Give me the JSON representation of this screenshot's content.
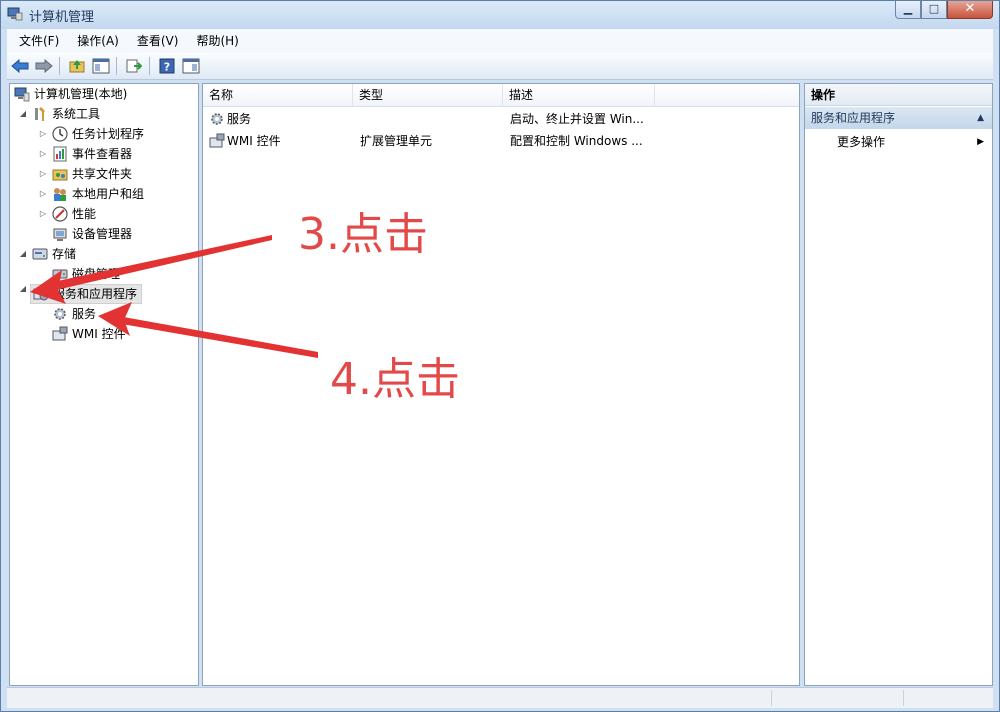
{
  "window": {
    "title": "计算机管理",
    "controls": {
      "minimize": "▁",
      "maximize": "□",
      "close": "✕"
    }
  },
  "menu": [
    "文件(F)",
    "操作(A)",
    "查看(V)",
    "帮助(H)"
  ],
  "toolbar": {
    "buttons": [
      "back-arrow-icon",
      "forward-arrow-icon",
      "up-folder-icon",
      "show-hide-tree-icon",
      "export-list-icon",
      "help-icon",
      "show-hide-action-pane-icon"
    ]
  },
  "tree": {
    "root": "计算机管理(本地)",
    "system_tools": "系统工具",
    "task_scheduler": "任务计划程序",
    "event_viewer": "事件查看器",
    "shared_folders": "共享文件夹",
    "local_users": "本地用户和组",
    "performance": "性能",
    "device_manager": "设备管理器",
    "storage": "存储",
    "disk_management": "磁盘管理",
    "services_apps": "服务和应用程序",
    "services": "服务",
    "wmi": "WMI 控件"
  },
  "list": {
    "columns": [
      "名称",
      "类型",
      "描述"
    ],
    "rows": [
      {
        "name": "服务",
        "type": "",
        "desc": "启动、终止并设置 Win..."
      },
      {
        "name": "WMI 控件",
        "type": "扩展管理单元",
        "desc": "配置和控制 Windows ..."
      }
    ]
  },
  "actions": {
    "header": "操作",
    "section": "服务和应用程序",
    "more": "更多操作"
  },
  "annotations": {
    "step3": "3.点击",
    "step4": "4.点击"
  },
  "colors": {
    "annotation": "#e24a4a",
    "window_frame": "#cfe0f3",
    "action_section": "#c5d6ea"
  }
}
